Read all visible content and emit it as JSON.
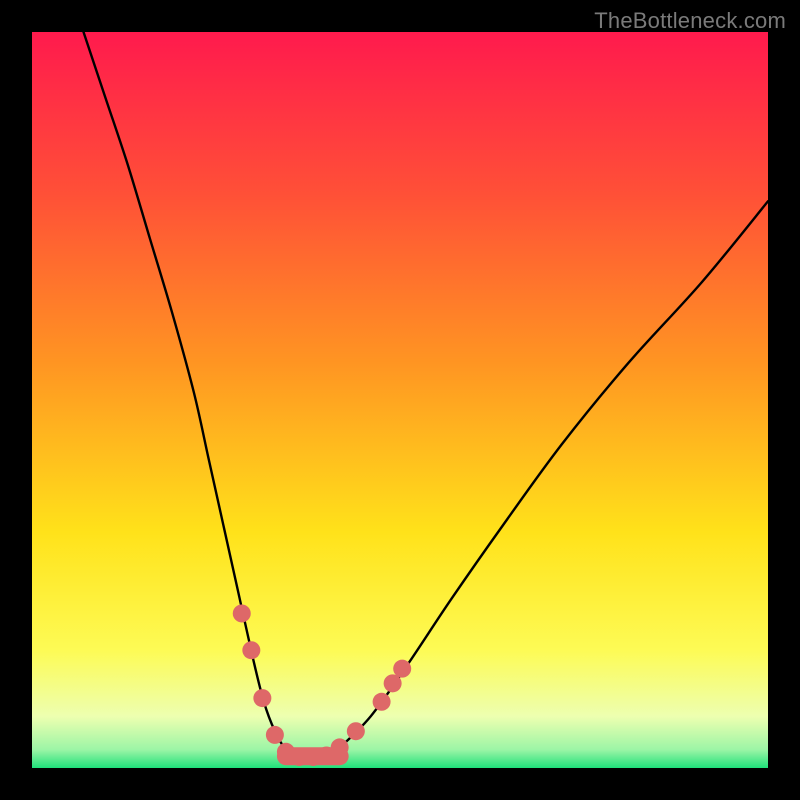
{
  "watermark": "TheBottleneck.com",
  "gradient": {
    "c0": "#ff1a4d",
    "c1": "#ff5037",
    "c2": "#ff9522",
    "c3": "#ffe21a",
    "c4": "#fdfb55",
    "c5": "#edffb0",
    "c6": "#9cf5a6",
    "c7": "#1fe07a"
  },
  "chart_data": {
    "type": "line",
    "title": "",
    "xlabel": "",
    "ylabel": "",
    "xlim": [
      0,
      100
    ],
    "ylim": [
      0,
      100
    ],
    "series": [
      {
        "name": "v-curve",
        "x": [
          7,
          10,
          13,
          16,
          19,
          22,
          24,
          26,
          28,
          30,
          31.5,
          33,
          34.5,
          36,
          40,
          41.5,
          46,
          51,
          57,
          64,
          72,
          81,
          91,
          100
        ],
        "y": [
          100,
          91,
          82,
          72,
          62,
          51,
          42,
          33,
          24,
          15,
          9,
          5,
          2.5,
          1.5,
          1.5,
          2.5,
          7,
          14,
          23,
          33,
          44,
          55,
          66,
          77
        ]
      }
    ],
    "markers": {
      "name": "highlight-dots",
      "color": "#de6868",
      "points": [
        {
          "x": 28.5,
          "y": 21
        },
        {
          "x": 29.8,
          "y": 16
        },
        {
          "x": 31.3,
          "y": 9.5
        },
        {
          "x": 33.0,
          "y": 4.5
        },
        {
          "x": 34.5,
          "y": 2.2
        },
        {
          "x": 36.3,
          "y": 1.5
        },
        {
          "x": 38.2,
          "y": 1.5
        },
        {
          "x": 40.0,
          "y": 1.7
        },
        {
          "x": 41.8,
          "y": 2.8
        },
        {
          "x": 44.0,
          "y": 5.0
        },
        {
          "x": 47.5,
          "y": 9.0
        },
        {
          "x": 49.0,
          "y": 11.5
        },
        {
          "x": 50.3,
          "y": 13.5
        }
      ]
    }
  }
}
